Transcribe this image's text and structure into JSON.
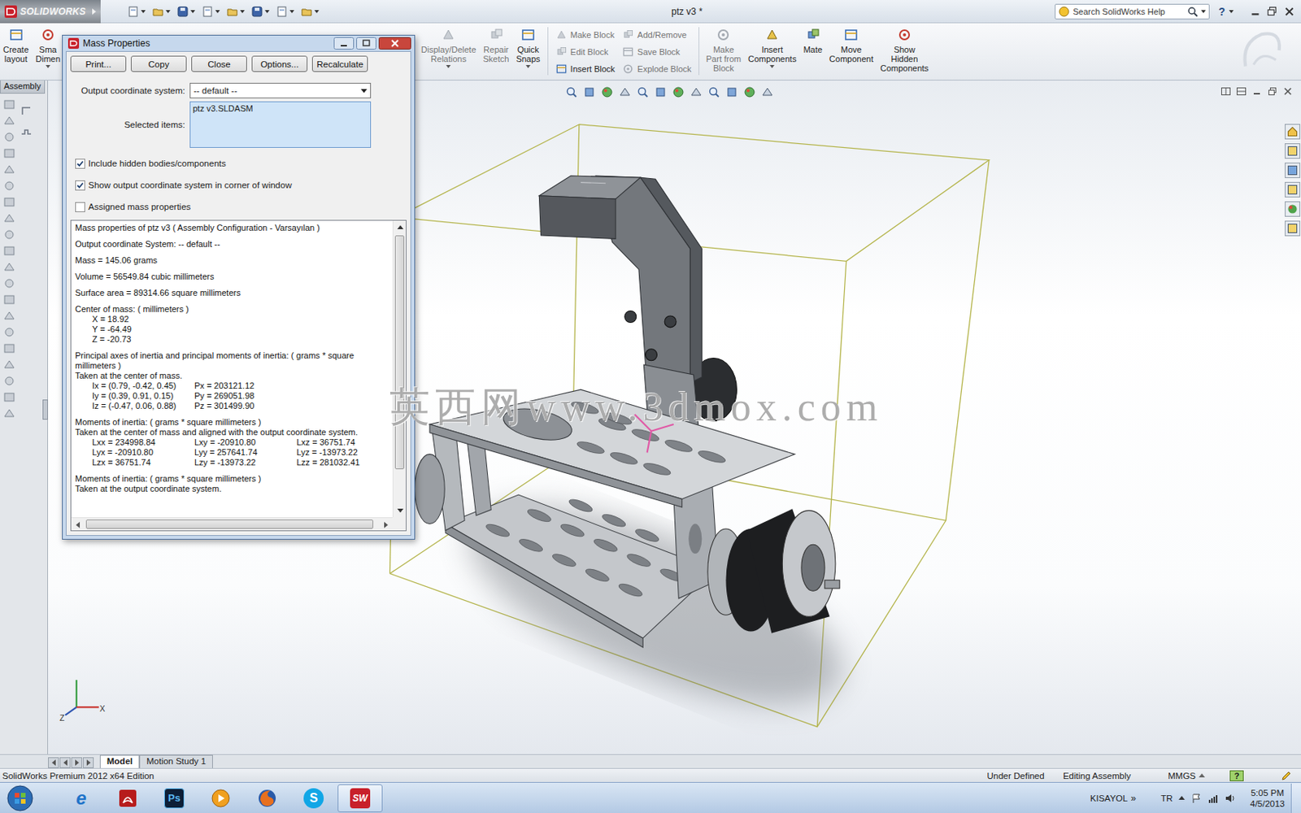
{
  "app": {
    "logo": "SOLIDWORKS",
    "title": "ptz v3 *",
    "search_placeholder": "Search SolidWorks Help",
    "help": "?"
  },
  "ribbon": {
    "left": [
      {
        "kind": "large",
        "lines": [
          "Create",
          "layout"
        ],
        "disabled": false,
        "dropdown": false
      },
      {
        "kind": "large",
        "lines": [
          "Sma",
          "Dimen"
        ],
        "disabled": false,
        "dropdown": true
      }
    ],
    "right": [
      {
        "kind": "large",
        "lines": [
          "Display/Delete",
          "Relations"
        ],
        "disabled": true,
        "dropdown": true
      },
      {
        "kind": "large",
        "lines": [
          "Repair",
          "Sketch"
        ],
        "disabled": true,
        "dropdown": false
      },
      {
        "kind": "large",
        "lines": [
          "Quick",
          "Snaps"
        ],
        "disabled": false,
        "dropdown": true
      },
      {
        "kind": "separator"
      },
      {
        "kind": "stack",
        "entries": [
          {
            "label": "Make Block",
            "disabled": true
          },
          {
            "label": "Edit Block",
            "disabled": true
          },
          {
            "label": "Insert Block",
            "disabled": false
          }
        ]
      },
      {
        "kind": "stack",
        "entries": [
          {
            "label": "Add/Remove",
            "disabled": true
          },
          {
            "label": "Save Block",
            "disabled": true
          },
          {
            "label": "Explode Block",
            "disabled": true
          }
        ]
      },
      {
        "kind": "separator"
      },
      {
        "kind": "large",
        "lines": [
          "Make",
          "Part from",
          "Block"
        ],
        "disabled": true,
        "dropdown": false
      },
      {
        "kind": "large",
        "lines": [
          "Insert",
          "Components"
        ],
        "disabled": false,
        "dropdown": true
      },
      {
        "kind": "large",
        "lines": [
          "Mate"
        ],
        "disabled": false,
        "dropdown": false
      },
      {
        "kind": "large",
        "lines": [
          "Move",
          "Component"
        ],
        "disabled": false,
        "dropdown": false
      },
      {
        "kind": "large",
        "lines": [
          "Show",
          "Hidden",
          "Components"
        ],
        "disabled": false,
        "dropdown": false
      }
    ]
  },
  "panel_tabs": [
    {
      "label": "Assembly",
      "selected": true
    }
  ],
  "dialog": {
    "title": "Mass Properties",
    "buttons": [
      "Print...",
      "Copy",
      "Close",
      "Options...",
      "Recalculate"
    ],
    "coord_label": "Output coordinate system:",
    "coord_value": "-- default --",
    "selected_label": "Selected items:",
    "selected_items": [
      "ptz v3.SLDASM"
    ],
    "checkboxes": [
      {
        "label": "Include hidden bodies/components",
        "checked": true
      },
      {
        "label": "Show output coordinate system in corner of window",
        "checked": true
      },
      {
        "label": "Assigned mass properties",
        "checked": false
      }
    ],
    "results": [
      {
        "lines": [
          {
            "kind": "text",
            "text": "Mass properties of ptz v3 ( Assembly Configuration - Varsayılan )"
          }
        ]
      },
      {
        "lines": [
          {
            "kind": "text",
            "text": "Output  coordinate System: -- default --"
          }
        ]
      },
      {
        "lines": [
          {
            "kind": "text",
            "text": "Mass = 145.06 grams"
          }
        ]
      },
      {
        "lines": [
          {
            "kind": "text",
            "text": "Volume = 56549.84  cubic millimeters"
          }
        ]
      },
      {
        "lines": [
          {
            "kind": "text",
            "text": "Surface area = 89314.66  square millimeters"
          }
        ]
      },
      {
        "lines": [
          {
            "kind": "text",
            "text": "Center of mass: ( millimeters )"
          },
          {
            "kind": "indent",
            "text": "X = 18.92"
          },
          {
            "kind": "indent",
            "text": "Y = -64.49"
          },
          {
            "kind": "indent",
            "text": "Z = -20.73"
          }
        ]
      },
      {
        "lines": [
          {
            "kind": "text",
            "text": "Principal axes of inertia and principal moments of inertia: ( grams *  square millimeters )"
          },
          {
            "kind": "text",
            "text": "Taken at the center of mass."
          },
          {
            "kind": "cols",
            "cells": [
              "Ix = (0.79, -0.42, 0.45)",
              "Px = 203121.12"
            ]
          },
          {
            "kind": "cols",
            "cells": [
              "Iy = (0.39, 0.91, 0.15)",
              "Py = 269051.98"
            ]
          },
          {
            "kind": "cols",
            "cells": [
              "Iz = (-0.47, 0.06, 0.88)",
              "Pz = 301499.90"
            ]
          }
        ]
      },
      {
        "lines": [
          {
            "kind": "text",
            "text": "Moments of inertia: ( grams *  square millimeters )"
          },
          {
            "kind": "text",
            "text": "Taken at the center of mass and aligned with the output coordinate system."
          },
          {
            "kind": "cols",
            "cells": [
              "Lxx = 234998.84",
              "Lxy = -20910.80",
              "Lxz = 36751.74"
            ]
          },
          {
            "kind": "cols",
            "cells": [
              "Lyx = -20910.80",
              "Lyy = 257641.74",
              "Lyz = -13973.22"
            ]
          },
          {
            "kind": "cols",
            "cells": [
              "Lzx = 36751.74",
              "Lzy = -13973.22",
              "Lzz = 281032.41"
            ]
          }
        ]
      },
      {
        "lines": [
          {
            "kind": "text",
            "text": "Moments of inertia: ( grams *  square millimeters )"
          },
          {
            "kind": "text",
            "text": "Taken at the output coordinate system."
          }
        ]
      }
    ]
  },
  "viewport": {
    "watermark": "英西网www.3dmox.com",
    "triad": {
      "x": "X",
      "z": "Z"
    }
  },
  "bottom_tabs": [
    {
      "label": "Model",
      "selected": true
    },
    {
      "label": "Motion Study 1",
      "selected": false
    }
  ],
  "status_bar": {
    "edition": "SolidWorks Premium 2012 x64 Edition",
    "items": [
      "Under Defined",
      "Editing Assembly"
    ],
    "units": "MMGS",
    "help": "?"
  },
  "taskbar": {
    "apps": [
      {
        "kind": "ie",
        "label": "e",
        "selected": false
      },
      {
        "kind": "acrobat",
        "label": "",
        "selected": false
      },
      {
        "kind": "photoshop",
        "label": "Ps",
        "selected": false
      },
      {
        "kind": "media",
        "label": "",
        "selected": false
      },
      {
        "kind": "firefox",
        "label": "",
        "selected": false
      },
      {
        "kind": "skype",
        "label": "S",
        "selected": false
      },
      {
        "kind": "solidworks",
        "label": "SW",
        "selected": true
      }
    ],
    "toolbar": "KISAYOL",
    "toolbar_more": "»",
    "language": "TR",
    "time": "5:05 PM",
    "date": "4/5/2013"
  }
}
